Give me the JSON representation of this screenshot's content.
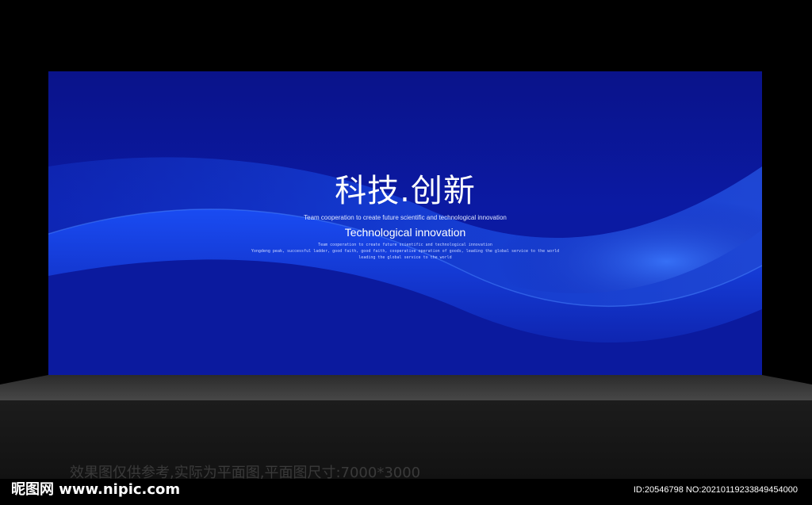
{
  "backdrop": {
    "title_cn": "科技.创新",
    "tagline": "Team cooperation to create future scientific and technological innovation",
    "title_en": "Technological innovation",
    "small_lines": [
      "Team cooperation to create future scientific and technological innovation",
      "Yongdeng peak, successful ladder, good faith, good faith, cooperative operation of goods, leading the global service to the world",
      "leading the global service to the world"
    ]
  },
  "footer": {
    "note": "效果图仅供参考,实际为平面图,平面图尺寸:7000*3000",
    "brand": "昵图网 www.nipic.com",
    "image_id": "ID:20546798 NO:20210119233849454000"
  },
  "colors": {
    "backdrop_dark": "#0a138a",
    "wave_bright": "#1f5cff",
    "floor": "#3a3a3a",
    "background": "#000000"
  }
}
